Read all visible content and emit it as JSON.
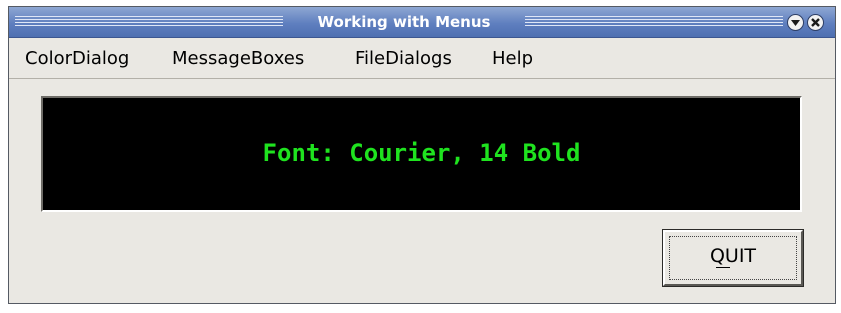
{
  "window": {
    "title": "Working with Menus"
  },
  "titlebar": {
    "buttons": [
      {
        "icon": "shade-arrow-icon"
      },
      {
        "icon": "close-icon"
      }
    ]
  },
  "menubar": {
    "items": [
      {
        "label": "ColorDialog"
      },
      {
        "label": "MessageBoxes"
      },
      {
        "label": "FileDialogs"
      },
      {
        "label": "Help"
      }
    ]
  },
  "display": {
    "text": "Font: Courier, 14 Bold",
    "text_color": "#1fe31f",
    "background": "#000000"
  },
  "quit_button": {
    "label": "QUIT"
  },
  "colors": {
    "titlebar": "#5f7fbf",
    "window_bg": "#eae8e3"
  }
}
